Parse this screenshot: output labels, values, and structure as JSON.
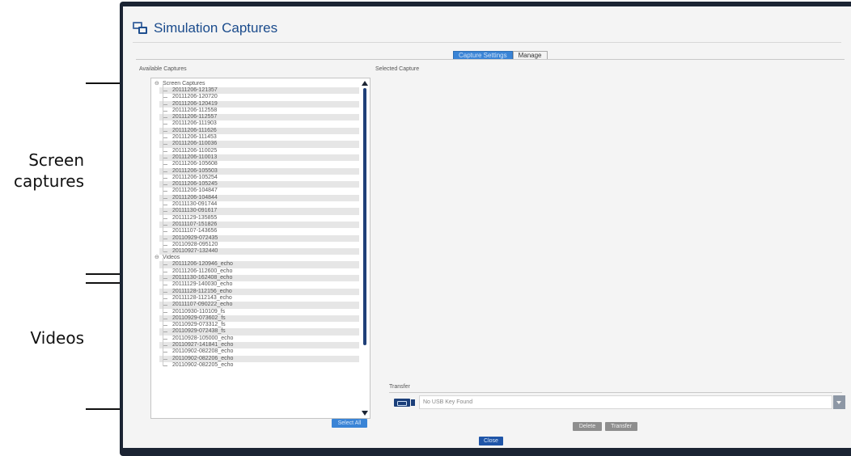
{
  "window": {
    "title": "Simulation Captures"
  },
  "tabs": [
    {
      "label": "Capture Settings",
      "active": true
    },
    {
      "label": "Manage",
      "active": false
    }
  ],
  "panels": {
    "available_label": "Available Captures",
    "selected_label": "Selected Capture"
  },
  "tree": {
    "screen_captures": {
      "label": "Screen Captures",
      "toggle": "⊖",
      "items": [
        "20111206-121357",
        "20111206-120720",
        "20111206-120419",
        "20111206-112558",
        "20111206-112557",
        "20111206-111903",
        "20111206-111626",
        "20111206-111453",
        "20111206-110036",
        "20111206-110025",
        "20111206-110013",
        "20111206-105608",
        "20111206-105503",
        "20111206-105254",
        "20111206-105245",
        "20111206-104847",
        "20111206-104844",
        "20111130-091744",
        "20111130-091617",
        "20111129-135855",
        "20111107-151826",
        "20111107-143656",
        "20110929-072435",
        "20110928-095120",
        "20110927-132440"
      ]
    },
    "videos": {
      "label": "Videos",
      "toggle": "⊖",
      "items": [
        "20111206-120946_echo",
        "20111206-112600_echo",
        "20111130-162408_echo",
        "20111129-140030_echo",
        "20111128-112156_echo",
        "20111128-112143_echo",
        "20111107-090222_echo",
        "20110930-110109_fs",
        "20110929-073602_fs",
        "20110929-073312_fs",
        "20110929-072438_fs",
        "20110928-105000_echo",
        "20110927-141841_echo",
        "20110902-082208_echo",
        "20110902-082206_echo",
        "20110902-082205_echo"
      ]
    }
  },
  "transfer": {
    "label": "Transfer",
    "usb_placeholder": "No USB Key Found"
  },
  "buttons": {
    "select_all": "Select All",
    "delete": "Delete",
    "transfer": "Transfer",
    "close": "Close"
  },
  "annotations": {
    "screen_captures": "Screen\ncaptures",
    "videos": "Videos"
  },
  "colors": {
    "accent": "#3a84d6",
    "title": "#1a4b8c",
    "frame": "#1b2433",
    "row_shade": "#e6e6e6"
  }
}
